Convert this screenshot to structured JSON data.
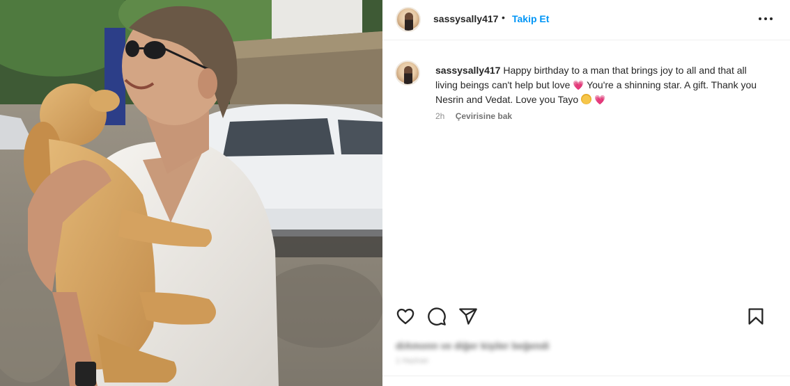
{
  "post": {
    "username": "sassysally417",
    "separator": "•",
    "follow_label": "Takip Et",
    "more_icon": "more-horizontal-icon"
  },
  "caption": {
    "username": "sassysally417",
    "text_part1": "Happy birthday to a man that brings joy to all and that all living beings can't help but love",
    "heart1": "💗",
    "text_part2": "You're a shinning star. A gift. Thank you Nesrin and Vedat. Love you Tayo",
    "heart2": "💗",
    "time": "2h",
    "see_translation": "Çevirisine bak"
  },
  "actions": {
    "like_icon": "heart-icon",
    "comment_icon": "comment-icon",
    "share_icon": "send-icon",
    "save_icon": "bookmark-icon"
  },
  "likes": {
    "text": "diAmonn ve diğer kişiler beğendi",
    "timestamp": "1 Haziran"
  },
  "colors": {
    "accent": "#0095f6",
    "text": "#262626",
    "muted": "#8e8e8e",
    "heart_emoji": "#e4407a"
  }
}
